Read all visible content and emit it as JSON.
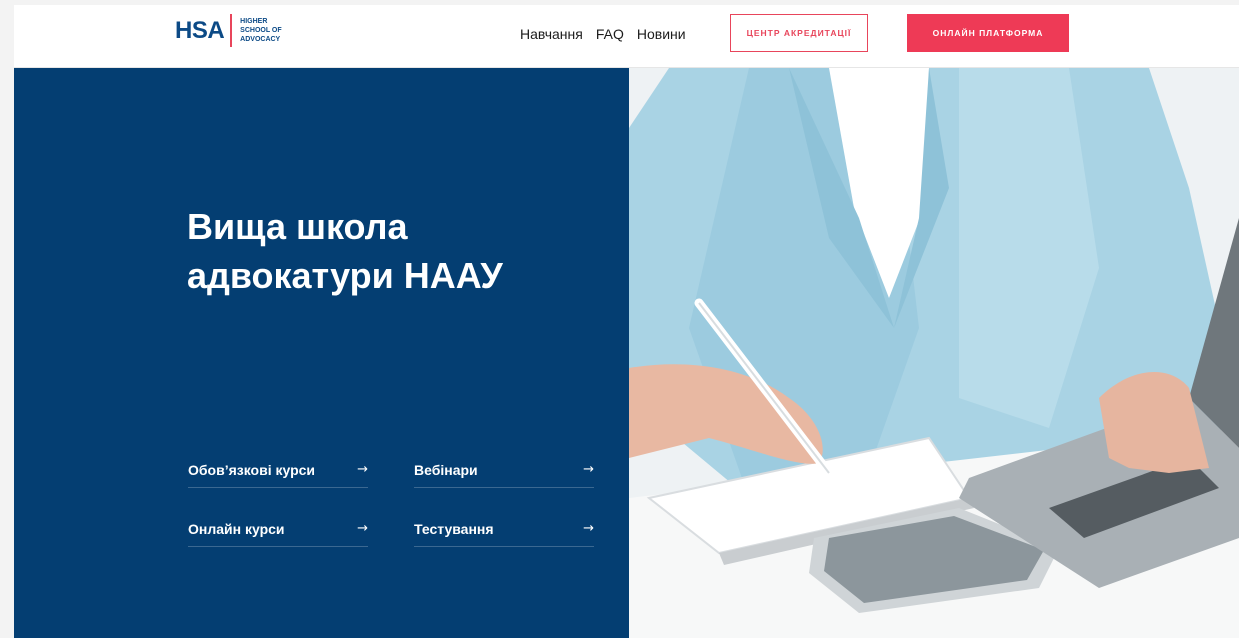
{
  "logo": {
    "main": "HSA",
    "sub": "HIGHER\nSCHOOL OF\nADVOCACY"
  },
  "nav": {
    "items": [
      "Навчання",
      "FAQ",
      "Новини"
    ]
  },
  "buttons": {
    "accreditation": "ЦЕНТР АКРЕДИТАЦІЇ",
    "online_platform": "ОНЛАЙН ПЛАТФОРМА"
  },
  "hero": {
    "title": "Вища школа\nадвокатури НААУ",
    "links": [
      {
        "label": "Обов’язкові курси",
        "icon": "arrow-right-icon"
      },
      {
        "label": "Вебінари",
        "icon": "arrow-right-icon"
      },
      {
        "label": "Онлайн курси",
        "icon": "arrow-right-icon"
      },
      {
        "label": "Тестування",
        "icon": "arrow-right-icon"
      }
    ],
    "arrow": "→"
  },
  "colors": {
    "brand_blue": "#043e72",
    "accent_red": "#ee3a56",
    "logo_blue": "#0c4a86"
  }
}
